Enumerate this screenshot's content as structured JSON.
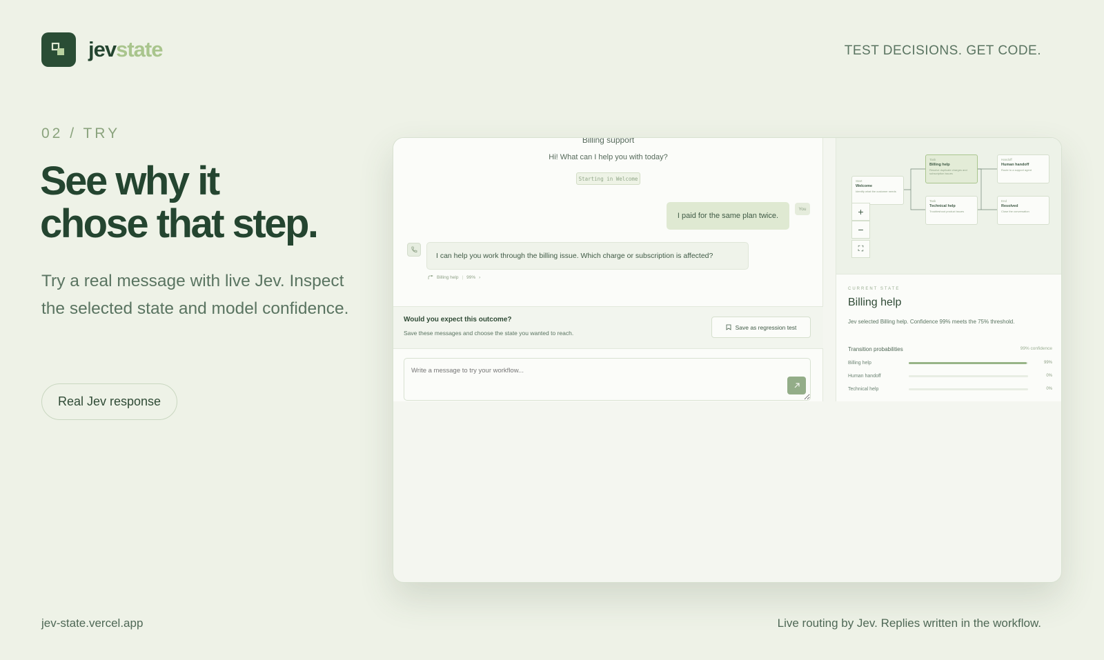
{
  "brand": {
    "name_part1": "jev",
    "name_part2": "state",
    "tagline": "TEST DECISIONS. GET CODE."
  },
  "hero": {
    "section_label": "02 / TRY",
    "headline_line1": "See why it",
    "headline_line2": "chose that step.",
    "lead": "Try a real message with live Jev. Inspect the selected state and model confidence.",
    "cta_label": "Real Jev response"
  },
  "demo": {
    "chat": {
      "title": "Billing support",
      "greeting": "Hi! What can I help you with today?",
      "start_chip": "Starting in Welcome",
      "user_message": "I paid for the same plan twice.",
      "user_badge": "You",
      "bot_message": "I can help you work through the billing issue. Which charge or subscription is affected?",
      "route_state": "Billing help",
      "route_confidence": "99%",
      "route_chevron": "›"
    },
    "outcome": {
      "question": "Would you expect this outcome?",
      "hint": "Save these messages and choose the state you wanted to reach.",
      "save_label": "Save as regression test"
    },
    "input": {
      "placeholder": "Write a message to try your workflow..."
    },
    "graph": {
      "nodes": [
        {
          "tag": "Start",
          "title": "Welcome",
          "desc": "Identify what the customer needs"
        },
        {
          "tag": "Task",
          "title": "Billing help",
          "desc": "Resolve duplicate charges and subscription issues"
        },
        {
          "tag": "Task",
          "title": "Technical help",
          "desc": "Troubleshoot product issues"
        },
        {
          "tag": "Handoff",
          "title": "Human handoff",
          "desc": "Route to a support agent"
        },
        {
          "tag": "End",
          "title": "Resolved",
          "desc": "Close the conversation"
        }
      ],
      "zoom_in": "+",
      "zoom_out": "−",
      "fit": "⛶"
    },
    "inspector": {
      "label": "CURRENT STATE",
      "state_title": "Billing help",
      "state_desc": "Jev selected Billing help. Confidence 99% meets the 75% threshold.",
      "tp_title": "Transition probabilities",
      "tp_conf": "99% confidence",
      "transitions": [
        {
          "name": "Billing help",
          "value": 0.99,
          "label": "99%"
        },
        {
          "name": "Human handoff",
          "value": 0.0,
          "label": "0%"
        },
        {
          "name": "Technical help",
          "value": 0.0,
          "label": "0%"
        }
      ]
    }
  },
  "footer": {
    "url": "jev-state.vercel.app",
    "note": "Live routing by Jev. Replies written in the workflow."
  },
  "colors": {
    "brand_dark": "#2a4d35",
    "brand_light": "#a9c58d",
    "background": "#eef2e7"
  }
}
